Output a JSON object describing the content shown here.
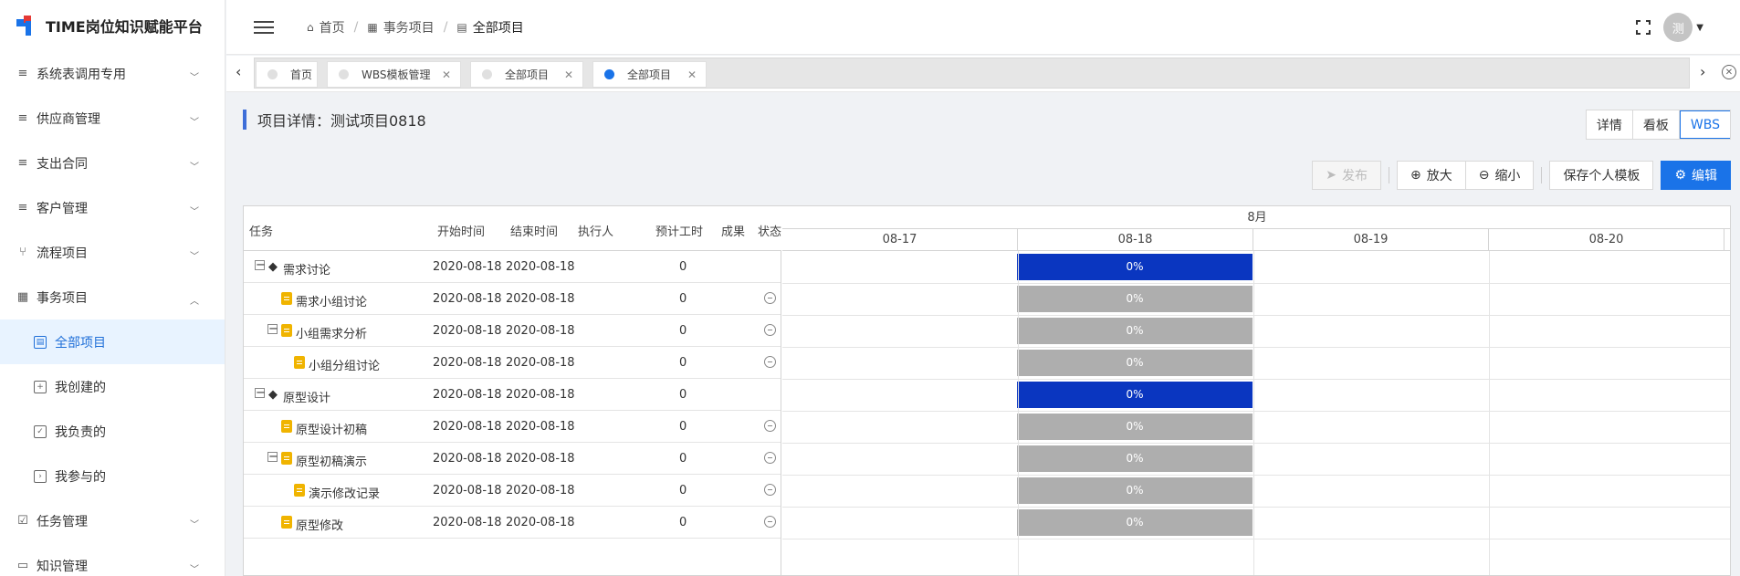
{
  "app": {
    "logo_text": "TIME岗位知识赋能平台"
  },
  "sidebar": {
    "items": [
      {
        "label": "系统表调用专用",
        "icon": "list-icon",
        "expanded": false
      },
      {
        "label": "供应商管理",
        "icon": "list-icon",
        "expanded": false
      },
      {
        "label": "支出合同",
        "icon": "list-icon",
        "expanded": false
      },
      {
        "label": "客户管理",
        "icon": "list-icon",
        "expanded": false
      },
      {
        "label": "流程项目",
        "icon": "branch-icon",
        "expanded": false
      },
      {
        "label": "事务项目",
        "icon": "grid-icon",
        "expanded": true
      },
      {
        "label": "任务管理",
        "icon": "checkbox-icon",
        "expanded": false
      },
      {
        "label": "知识管理",
        "icon": "book-icon",
        "expanded": false
      }
    ],
    "sub_items": [
      {
        "label": "全部项目",
        "active": true
      },
      {
        "label": "我创建的",
        "active": false
      },
      {
        "label": "我负责的",
        "active": false
      },
      {
        "label": "我参与的",
        "active": false
      }
    ]
  },
  "header": {
    "breadcrumb": [
      "首页",
      "事务项目",
      "全部项目"
    ],
    "avatar_text": "测"
  },
  "tabs": [
    {
      "label": "首页",
      "closable": false,
      "active": false
    },
    {
      "label": "WBS模板管理",
      "closable": true,
      "active": false
    },
    {
      "label": "全部项目",
      "closable": true,
      "active": false
    },
    {
      "label": "全部项目",
      "closable": true,
      "active": true
    }
  ],
  "page": {
    "title": "项目详情：测试项目0818",
    "views": [
      "详情",
      "看板",
      "WBS"
    ],
    "active_view": "WBS",
    "toolbar": {
      "publish": "发布",
      "zoom_in": "放大",
      "zoom_out": "缩小",
      "save_template": "保存个人模板",
      "edit": "编辑"
    }
  },
  "table": {
    "columns": [
      "任务",
      "开始时间",
      "结束时间",
      "执行人",
      "预计工时",
      "成果",
      "状态"
    ],
    "rows": [
      {
        "task": "需求讨论",
        "level": 0,
        "type": "group",
        "toggle": true,
        "start": "2020-08-18",
        "end": "2020-08-18",
        "hours": "0",
        "status": false,
        "progress": "0%",
        "bar": "blue"
      },
      {
        "task": "需求小组讨论",
        "level": 1,
        "type": "task",
        "toggle": false,
        "start": "2020-08-18",
        "end": "2020-08-18",
        "hours": "0",
        "status": true,
        "progress": "0%",
        "bar": "grey"
      },
      {
        "task": "小组需求分析",
        "level": 1,
        "type": "task",
        "toggle": true,
        "start": "2020-08-18",
        "end": "2020-08-18",
        "hours": "0",
        "status": true,
        "progress": "0%",
        "bar": "grey"
      },
      {
        "task": "小组分组讨论",
        "level": 2,
        "type": "task",
        "toggle": false,
        "start": "2020-08-18",
        "end": "2020-08-18",
        "hours": "0",
        "status": true,
        "progress": "0%",
        "bar": "grey"
      },
      {
        "task": "原型设计",
        "level": 0,
        "type": "group",
        "toggle": true,
        "start": "2020-08-18",
        "end": "2020-08-18",
        "hours": "0",
        "status": false,
        "progress": "0%",
        "bar": "blue"
      },
      {
        "task": "原型设计初稿",
        "level": 1,
        "type": "task",
        "toggle": false,
        "start": "2020-08-18",
        "end": "2020-08-18",
        "hours": "0",
        "status": true,
        "progress": "0%",
        "bar": "grey"
      },
      {
        "task": "原型初稿演示",
        "level": 1,
        "type": "task",
        "toggle": true,
        "start": "2020-08-18",
        "end": "2020-08-18",
        "hours": "0",
        "status": true,
        "progress": "0%",
        "bar": "grey"
      },
      {
        "task": "演示修改记录",
        "level": 2,
        "type": "task",
        "toggle": false,
        "start": "2020-08-18",
        "end": "2020-08-18",
        "hours": "0",
        "status": true,
        "progress": "0%",
        "bar": "grey"
      },
      {
        "task": "原型修改",
        "level": 1,
        "type": "task",
        "toggle": false,
        "start": "2020-08-18",
        "end": "2020-08-18",
        "hours": "0",
        "status": true,
        "progress": "0%",
        "bar": "grey"
      }
    ]
  },
  "gantt": {
    "month": "8月",
    "days": [
      "08-17",
      "08-18",
      "08-19",
      "08-20"
    ]
  },
  "colors": {
    "accent": "#1a73e8",
    "bar_group": "#0a36c0",
    "bar_task": "#aeaeae"
  }
}
